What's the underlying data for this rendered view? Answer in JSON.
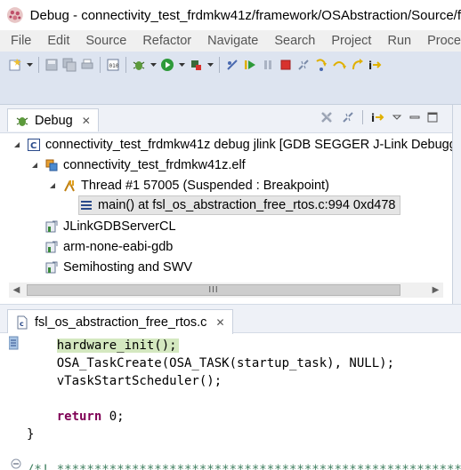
{
  "window": {
    "title": "Debug - connectivity_test_frdmkw41z/framework/OSAbstraction/Source/fs"
  },
  "menu": [
    "File",
    "Edit",
    "Source",
    "Refactor",
    "Navigate",
    "Search",
    "Project",
    "Run",
    "Processor"
  ],
  "debug_view": {
    "tab_label": "Debug",
    "tree": [
      {
        "label": "connectivity_test_frdmkw41z debug jlink [GDB SEGGER J-Link Debugg",
        "icon": "launch-config-icon",
        "expanded": true
      },
      {
        "label": "connectivity_test_frdmkw41z.elf",
        "icon": "debug-target-icon",
        "expanded": true
      },
      {
        "label": "Thread #1 57005 (Suspended : Breakpoint)",
        "icon": "thread-suspended-icon",
        "expanded": true
      },
      {
        "label": "main() at fsl_os_abstraction_free_rtos.c:994 0xd478",
        "icon": "stack-frame-icon",
        "selected": true
      },
      {
        "label": "JLinkGDBServerCL",
        "icon": "process-icon"
      },
      {
        "label": "arm-none-eabi-gdb",
        "icon": "process-icon"
      },
      {
        "label": "Semihosting and SWV",
        "icon": "process-icon"
      }
    ],
    "scroll_thumb_label": "III"
  },
  "editor": {
    "tab_label": "fsl_os_abstraction_free_rtos.c",
    "lines": [
      "    hardware_init();",
      "    OSA_TaskCreate(OSA_TASK(startup_task), NULL);",
      "    vTaskStartScheduler();",
      "",
      "    return 0;",
      "}",
      "",
      "/*! ******************************************************"
    ]
  },
  "colors": {
    "toolbar_bg": "#dde4f0",
    "current_line_highlight": "#d4e8c0",
    "keyword": "#7f0055",
    "comment": "#3f7f5f"
  }
}
